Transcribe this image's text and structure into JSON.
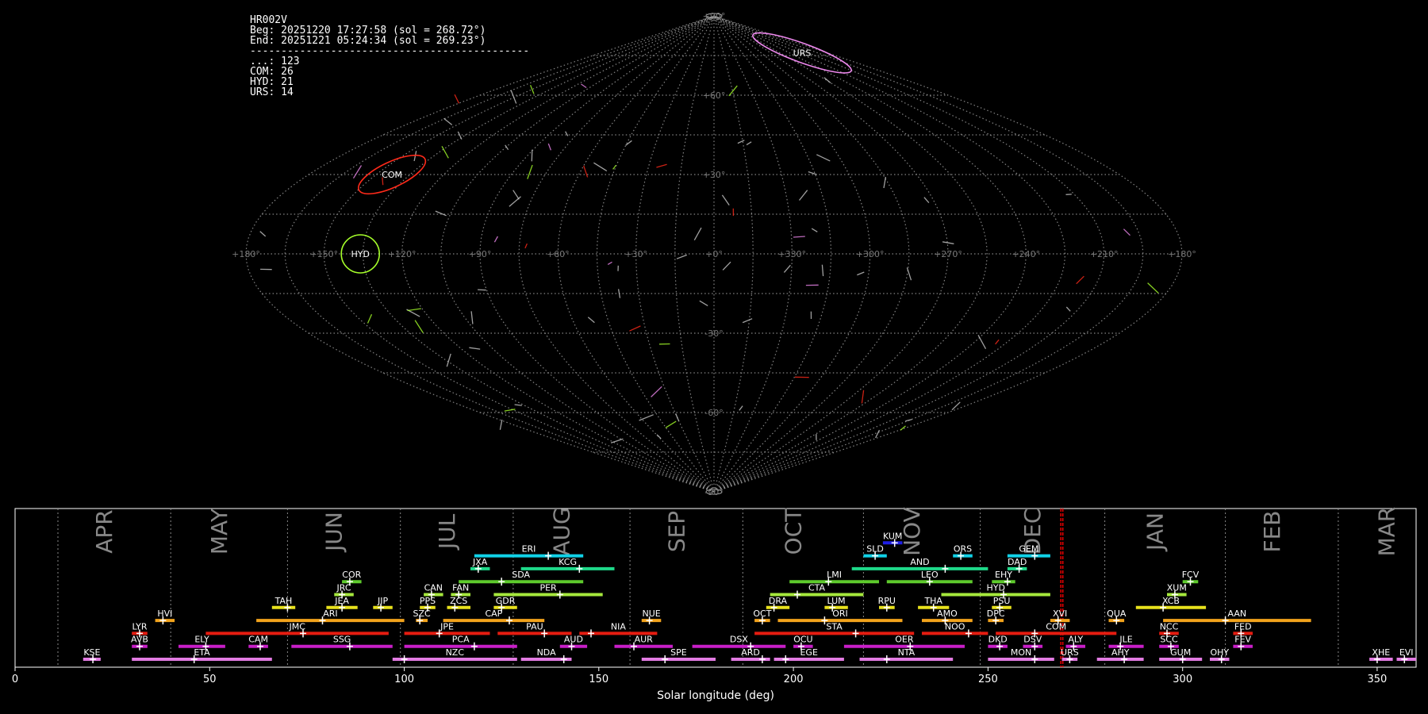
{
  "info": {
    "lines": [
      "HR002V",
      "Beg: 20251220 17:27:58 (sol = 268.72°)",
      "End: 20251221 05:24:34 (sol = 269.23°)",
      "---------------------------------------------",
      "...: 123",
      "COM: 26",
      "HYD: 21",
      "URS: 14"
    ]
  },
  "chart_data": [
    {
      "type": "scatter",
      "projection": "sinusoidal",
      "grid": true,
      "lon_labels": [
        "+180°",
        "+150°",
        "+120°",
        "+90°",
        "+60°",
        "+30°",
        "+0°",
        "+330°",
        "+300°",
        "+270°",
        "+240°",
        "+210°",
        "+180°"
      ],
      "lat_labels": [
        "+90°",
        "+60°",
        "+30°",
        "-30°",
        "-60°",
        "-90°"
      ],
      "radiants": [
        {
          "name": "COM",
          "lon": 143,
          "lat": 30,
          "color": "#ff2a1a"
        },
        {
          "name": "HYD",
          "lon": 136,
          "lat": 0,
          "color": "#a6ff2a"
        },
        {
          "name": "URS",
          "lon": 220,
          "lat": 76,
          "color": "#ee88ee"
        }
      ]
    },
    {
      "type": "table",
      "xlabel": "Solar longitude (deg)",
      "xlim": [
        0,
        360
      ],
      "xticks": [
        0,
        50,
        100,
        150,
        200,
        250,
        300,
        350
      ],
      "current_sol": [
        268.72,
        269.23
      ],
      "months": [
        {
          "name": "APR",
          "start": 11
        },
        {
          "name": "MAY",
          "start": 40
        },
        {
          "name": "JUN",
          "start": 70
        },
        {
          "name": "JUL",
          "start": 99
        },
        {
          "name": "AUG",
          "start": 128
        },
        {
          "name": "SEP",
          "start": 158
        },
        {
          "name": "OCT",
          "start": 187
        },
        {
          "name": "NOV",
          "start": 218
        },
        {
          "name": "DEC",
          "start": 248
        },
        {
          "name": "JAN",
          "start": 280
        },
        {
          "name": "FEB",
          "start": 311
        },
        {
          "name": "MAR",
          "start": 340
        }
      ],
      "showers": [
        {
          "name": "KSE",
          "start": 17.5,
          "end": 22,
          "peak": 20,
          "row": 0,
          "color": "#e27be2"
        },
        {
          "name": "ETA",
          "start": 30,
          "end": 66,
          "peak": 46,
          "row": 0,
          "color": "#e27be2"
        },
        {
          "name": "NZC",
          "start": 97,
          "end": 129,
          "peak": 100,
          "row": 0,
          "color": "#e27be2"
        },
        {
          "name": "NDA",
          "start": 130,
          "end": 143,
          "peak": 141,
          "row": 0,
          "color": "#e27be2"
        },
        {
          "name": "SPE",
          "start": 161,
          "end": 180,
          "peak": 167,
          "row": 0,
          "color": "#e27be2"
        },
        {
          "name": "ARD",
          "start": 184,
          "end": 194,
          "peak": 192,
          "row": 0,
          "color": "#e27be2"
        },
        {
          "name": "EGE",
          "start": 195,
          "end": 213,
          "peak": 198,
          "row": 0,
          "color": "#e27be2"
        },
        {
          "name": "NTA",
          "start": 217,
          "end": 241,
          "peak": 224,
          "row": 0,
          "color": "#e27be2"
        },
        {
          "name": "MON",
          "start": 250,
          "end": 267,
          "peak": 262,
          "row": 0,
          "color": "#e27be2"
        },
        {
          "name": "URS",
          "start": 269,
          "end": 273,
          "peak": 271,
          "row": 0,
          "color": "#e27be2"
        },
        {
          "name": "AHY",
          "start": 278,
          "end": 290,
          "peak": 285,
          "row": 0,
          "color": "#e27be2"
        },
        {
          "name": "GUM",
          "start": 294,
          "end": 305,
          "peak": 300,
          "row": 0,
          "color": "#e27be2"
        },
        {
          "name": "OHY",
          "start": 307,
          "end": 312,
          "peak": 310,
          "row": 0,
          "color": "#e27be2"
        },
        {
          "name": "XHE",
          "start": 348,
          "end": 354,
          "peak": 350,
          "row": 0,
          "color": "#e27be2"
        },
        {
          "name": "EVI",
          "start": 355,
          "end": 360,
          "peak": 357,
          "row": 0,
          "color": "#e27be2"
        },
        {
          "name": "AVB",
          "start": 30,
          "end": 34,
          "peak": 32,
          "row": 1,
          "color": "#c81ec8"
        },
        {
          "name": "ELY",
          "start": 42,
          "end": 54,
          "peak": 49,
          "row": 1,
          "color": "#c81ec8"
        },
        {
          "name": "CAM",
          "start": 60,
          "end": 65,
          "peak": 63,
          "row": 1,
          "color": "#c81ec8"
        },
        {
          "name": "SSG",
          "start": 71,
          "end": 97,
          "peak": 86,
          "row": 1,
          "color": "#c81ec8"
        },
        {
          "name": "PCA",
          "start": 100,
          "end": 129,
          "peak": 118,
          "row": 1,
          "color": "#c81ec8"
        },
        {
          "name": "AUD",
          "start": 140,
          "end": 147,
          "peak": 143,
          "row": 1,
          "color": "#c81ec8"
        },
        {
          "name": "AUR",
          "start": 154,
          "end": 169,
          "peak": 159,
          "row": 1,
          "color": "#c81ec8"
        },
        {
          "name": "DSX",
          "start": 174,
          "end": 198,
          "peak": 189,
          "row": 1,
          "color": "#c81ec8"
        },
        {
          "name": "OCU",
          "start": 200,
          "end": 205,
          "peak": 202,
          "row": 1,
          "color": "#c81ec8"
        },
        {
          "name": "OER",
          "start": 213,
          "end": 244,
          "peak": 230,
          "row": 1,
          "color": "#c81ec8"
        },
        {
          "name": "DKD",
          "start": 250,
          "end": 255,
          "peak": 253,
          "row": 1,
          "color": "#c81ec8"
        },
        {
          "name": "DSV",
          "start": 259,
          "end": 264,
          "peak": 262,
          "row": 1,
          "color": "#c81ec8"
        },
        {
          "name": "ALY",
          "start": 270,
          "end": 275,
          "peak": 272,
          "row": 1,
          "color": "#c81ec8"
        },
        {
          "name": "JLE",
          "start": 281,
          "end": 290,
          "peak": 284,
          "row": 1,
          "color": "#c81ec8"
        },
        {
          "name": "SCC",
          "start": 294,
          "end": 299,
          "peak": 297,
          "row": 1,
          "color": "#c81ec8"
        },
        {
          "name": "FEV",
          "start": 313,
          "end": 318,
          "peak": 315,
          "row": 1,
          "color": "#c81ec8"
        },
        {
          "name": "LYR",
          "start": 30,
          "end": 34,
          "peak": 32,
          "row": 2,
          "color": "#e61c10"
        },
        {
          "name": "JMC",
          "start": 49,
          "end": 96,
          "peak": 74,
          "row": 2,
          "color": "#e61c10"
        },
        {
          "name": "JPE",
          "start": 100,
          "end": 122,
          "peak": 109,
          "row": 2,
          "color": "#e61c10"
        },
        {
          "name": "PAU",
          "start": 124,
          "end": 143,
          "peak": 136,
          "row": 2,
          "color": "#e61c10"
        },
        {
          "name": "NIA",
          "start": 145,
          "end": 165,
          "peak": 148,
          "row": 2,
          "color": "#e61c10"
        },
        {
          "name": "STA",
          "start": 190,
          "end": 231,
          "peak": 216,
          "row": 2,
          "color": "#e61c10"
        },
        {
          "name": "NOO",
          "start": 233,
          "end": 250,
          "peak": 245,
          "row": 2,
          "color": "#e61c10"
        },
        {
          "name": "COM",
          "start": 252,
          "end": 283,
          "peak": 262,
          "row": 2,
          "color": "#e61c10"
        },
        {
          "name": "NCC",
          "start": 294,
          "end": 299,
          "peak": 296,
          "row": 2,
          "color": "#e61c10"
        },
        {
          "name": "FED",
          "start": 313,
          "end": 318,
          "peak": 315,
          "row": 2,
          "color": "#e61c10"
        },
        {
          "name": "HVI",
          "start": 36,
          "end": 41,
          "peak": 38,
          "row": 3,
          "color": "#f2a31c"
        },
        {
          "name": "ARI",
          "start": 62,
          "end": 100,
          "peak": 79,
          "row": 3,
          "color": "#f2a31c"
        },
        {
          "name": "SZC",
          "start": 103,
          "end": 106,
          "peak": 104,
          "row": 3,
          "color": "#f2a31c"
        },
        {
          "name": "CAP",
          "start": 110,
          "end": 136,
          "peak": 127,
          "row": 3,
          "color": "#f2a31c"
        },
        {
          "name": "NUE",
          "start": 161,
          "end": 166,
          "peak": 163,
          "row": 3,
          "color": "#f2a31c"
        },
        {
          "name": "OCT",
          "start": 190,
          "end": 194,
          "peak": 192,
          "row": 3,
          "color": "#f2a31c"
        },
        {
          "name": "ORI",
          "start": 196,
          "end": 228,
          "peak": 208,
          "row": 3,
          "color": "#f2a31c"
        },
        {
          "name": "AMO",
          "start": 233,
          "end": 246,
          "peak": 239,
          "row": 3,
          "color": "#f2a31c"
        },
        {
          "name": "DPC",
          "start": 250,
          "end": 254,
          "peak": 252,
          "row": 3,
          "color": "#f2a31c"
        },
        {
          "name": "XVI",
          "start": 266,
          "end": 271,
          "peak": 268,
          "row": 3,
          "color": "#f2a31c"
        },
        {
          "name": "QUA",
          "start": 281,
          "end": 285,
          "peak": 283,
          "row": 3,
          "color": "#f2a31c"
        },
        {
          "name": "AAN",
          "start": 295,
          "end": 333,
          "peak": 311,
          "row": 3,
          "color": "#f2a31c"
        },
        {
          "name": "TAH",
          "start": 66,
          "end": 72,
          "peak": 70,
          "row": 4,
          "color": "#e8e11c"
        },
        {
          "name": "JEA",
          "start": 80,
          "end": 88,
          "peak": 84,
          "row": 4,
          "color": "#e8e11c"
        },
        {
          "name": "JIP",
          "start": 92,
          "end": 97,
          "peak": 94,
          "row": 4,
          "color": "#e8e11c"
        },
        {
          "name": "PPS",
          "start": 104,
          "end": 108,
          "peak": 106,
          "row": 4,
          "color": "#e8e11c"
        },
        {
          "name": "ZCS",
          "start": 111,
          "end": 117,
          "peak": 113,
          "row": 4,
          "color": "#e8e11c"
        },
        {
          "name": "GDR",
          "start": 123,
          "end": 129,
          "peak": 125,
          "row": 4,
          "color": "#e8e11c"
        },
        {
          "name": "DRA",
          "start": 193,
          "end": 199,
          "peak": 195,
          "row": 4,
          "color": "#e8e11c"
        },
        {
          "name": "LUM",
          "start": 208,
          "end": 214,
          "peak": 210,
          "row": 4,
          "color": "#e8e11c"
        },
        {
          "name": "RPU",
          "start": 222,
          "end": 226,
          "peak": 224,
          "row": 4,
          "color": "#e8e11c"
        },
        {
          "name": "THA",
          "start": 232,
          "end": 240,
          "peak": 236,
          "row": 4,
          "color": "#e8e11c"
        },
        {
          "name": "PSU",
          "start": 251,
          "end": 256,
          "peak": 253,
          "row": 4,
          "color": "#e8e11c"
        },
        {
          "name": "XCB",
          "start": 288,
          "end": 306,
          "peak": 295,
          "row": 4,
          "color": "#e8e11c"
        },
        {
          "name": "JRC",
          "start": 82,
          "end": 87,
          "peak": 84,
          "row": 5,
          "color": "#a6e83c"
        },
        {
          "name": "CAN",
          "start": 105,
          "end": 110,
          "peak": 107,
          "row": 5,
          "color": "#a6e83c"
        },
        {
          "name": "FAN",
          "start": 112,
          "end": 117,
          "peak": 114,
          "row": 5,
          "color": "#a6e83c"
        },
        {
          "name": "PER",
          "start": 123,
          "end": 151,
          "peak": 140,
          "row": 5,
          "color": "#a6e83c"
        },
        {
          "name": "CTA",
          "start": 194,
          "end": 218,
          "peak": 201,
          "row": 5,
          "color": "#a6e83c"
        },
        {
          "name": "HYD",
          "start": 238,
          "end": 266,
          "peak": 254,
          "row": 5,
          "color": "#a6e83c"
        },
        {
          "name": "XUM",
          "start": 296,
          "end": 301,
          "peak": 298,
          "row": 5,
          "color": "#a6e83c"
        },
        {
          "name": "COR",
          "start": 84,
          "end": 89,
          "peak": 86,
          "row": 6,
          "color": "#5ecb2c"
        },
        {
          "name": "SDA",
          "start": 114,
          "end": 146,
          "peak": 125,
          "row": 6,
          "color": "#5ecb2c"
        },
        {
          "name": "LMI",
          "start": 199,
          "end": 222,
          "peak": 209,
          "row": 6,
          "color": "#5ecb2c"
        },
        {
          "name": "LEO",
          "start": 224,
          "end": 246,
          "peak": 235,
          "row": 6,
          "color": "#5ecb2c"
        },
        {
          "name": "EHY",
          "start": 251,
          "end": 257,
          "peak": 255,
          "row": 6,
          "color": "#5ecb2c"
        },
        {
          "name": "FCV",
          "start": 300,
          "end": 304,
          "peak": 302,
          "row": 6,
          "color": "#5ecb2c"
        },
        {
          "name": "JXA",
          "start": 117,
          "end": 122,
          "peak": 119,
          "row": 7,
          "color": "#1ed98a"
        },
        {
          "name": "KCG",
          "start": 130,
          "end": 154,
          "peak": 145,
          "row": 7,
          "color": "#1ed98a"
        },
        {
          "name": "AND",
          "start": 215,
          "end": 250,
          "peak": 239,
          "row": 7,
          "color": "#1ed98a"
        },
        {
          "name": "DAD",
          "start": 255,
          "end": 260,
          "peak": 258,
          "row": 7,
          "color": "#1ed98a"
        },
        {
          "name": "ERI",
          "start": 118,
          "end": 146,
          "peak": 137,
          "row": 8,
          "color": "#10d2e8"
        },
        {
          "name": "SLD",
          "start": 218,
          "end": 224,
          "peak": 221,
          "row": 8,
          "color": "#10d2e8"
        },
        {
          "name": "ORS",
          "start": 241,
          "end": 246,
          "peak": 243,
          "row": 8,
          "color": "#10d2e8"
        },
        {
          "name": "GEM",
          "start": 255,
          "end": 266,
          "peak": 262,
          "row": 8,
          "color": "#10d2e8"
        },
        {
          "name": "KUM",
          "start": 223,
          "end": 228,
          "peak": 226,
          "row": 9,
          "color": "#1e1ee6"
        }
      ]
    }
  ]
}
